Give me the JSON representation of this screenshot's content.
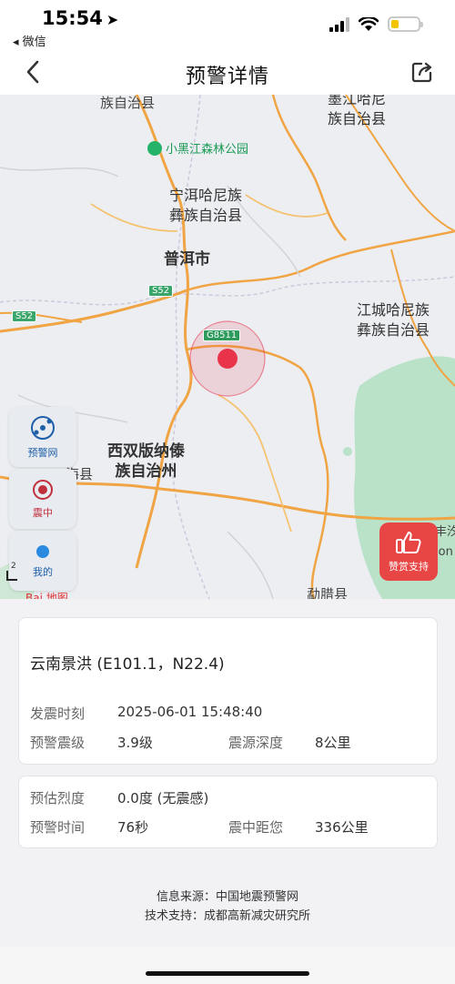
{
  "status_bar": {
    "time": "15:54",
    "back_app": "◂ 微信"
  },
  "nav": {
    "title": "预警详情"
  },
  "map": {
    "labels": {
      "top_left": "族自治县",
      "top_right": "墨江哈尼\n族自治县",
      "park": "小黑江森林公园",
      "ninger": "宁洱哈尼族\n彝族自治县",
      "puer": "普洱市",
      "jiangcheng": "江城哈尼族\n彝族自治县",
      "xishuangbanna": "西双版纳傣\n族自治州",
      "haixian": "海县",
      "mengla": "勐腊县",
      "right_edge": "丰汐\nion"
    },
    "roads": {
      "s52_a": "S52",
      "s52_b": "S52",
      "g8511": "G8511"
    },
    "tools": {
      "warning_net": "预警网",
      "epicenter": "震中",
      "mine": "我的"
    },
    "scale": "2",
    "baidu": "Bai 地图",
    "like_label": "赞赏支持",
    "colors": {
      "epicenter": "#e8334a",
      "green_area": "#b9e2c8"
    }
  },
  "card1": {
    "location": "云南景洪 (E101.1，N22.4)",
    "time_label": "发震时刻",
    "time_value": "2025-06-01 15:48:40",
    "magnitude_label": "预警震级",
    "magnitude_value": "3.9级",
    "depth_label": "震源深度",
    "depth_value": "8公里"
  },
  "card2": {
    "intensity_label": "预估烈度",
    "intensity_value": "0.0度 (无震感)",
    "warning_time_label": "预警时间",
    "warning_time_value": "76秒",
    "distance_label": "震中距您",
    "distance_value": "336公里"
  },
  "footer": {
    "source": "信息来源：中国地震预警网",
    "support": "技术支持：成都高新减灾研究所"
  }
}
